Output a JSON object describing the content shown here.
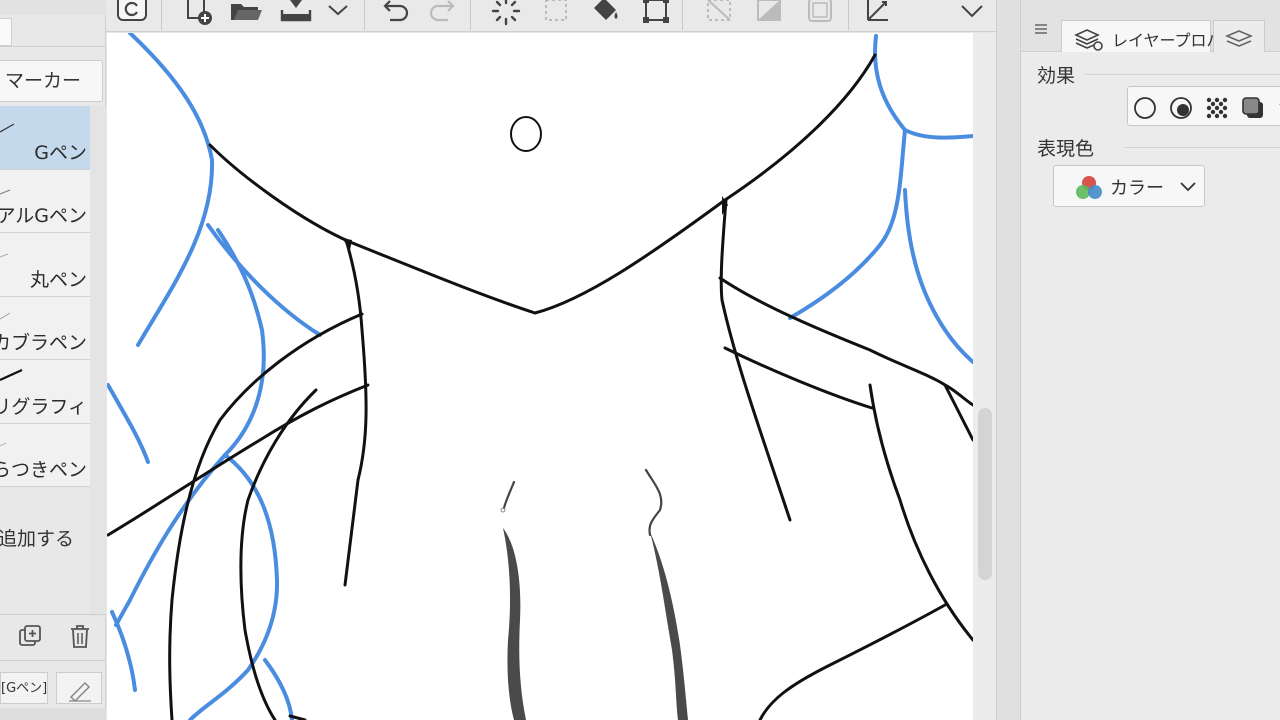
{
  "subtool_panel": {
    "group_label": "マーカー",
    "items": [
      {
        "label": "Gペン",
        "selected": true
      },
      {
        "label": "リアルGペン",
        "selected": false
      },
      {
        "label": "丸ペン",
        "selected": false
      },
      {
        "label": "カブラペン",
        "selected": false
      },
      {
        "label": "カリグラフィ",
        "selected": false
      },
      {
        "label": "ざらつきペン",
        "selected": false
      }
    ],
    "add_label": "追加する",
    "current_brush_label": "[Gペン]"
  },
  "toolbar": {
    "icons": [
      "app-logo-icon",
      "new-file-icon",
      "open-folder-icon",
      "save-icon",
      "dropdown-icon",
      "undo-icon",
      "redo-icon",
      "loading-icon",
      "selection-icon",
      "fill-icon",
      "transform-icon",
      "clear-icon",
      "fill-layer-icon",
      "frame-icon",
      "ruler-icon",
      "menu-icon"
    ]
  },
  "right_panel": {
    "tab_layer_property": "レイヤープロパ",
    "effect_heading": "効果",
    "expression_color_heading": "表現色",
    "expression_color_value": "カラー"
  },
  "colors": {
    "accent_blue": "#4a8ce0",
    "line_black": "#111111",
    "selection_bg": "#c5d9ec"
  }
}
